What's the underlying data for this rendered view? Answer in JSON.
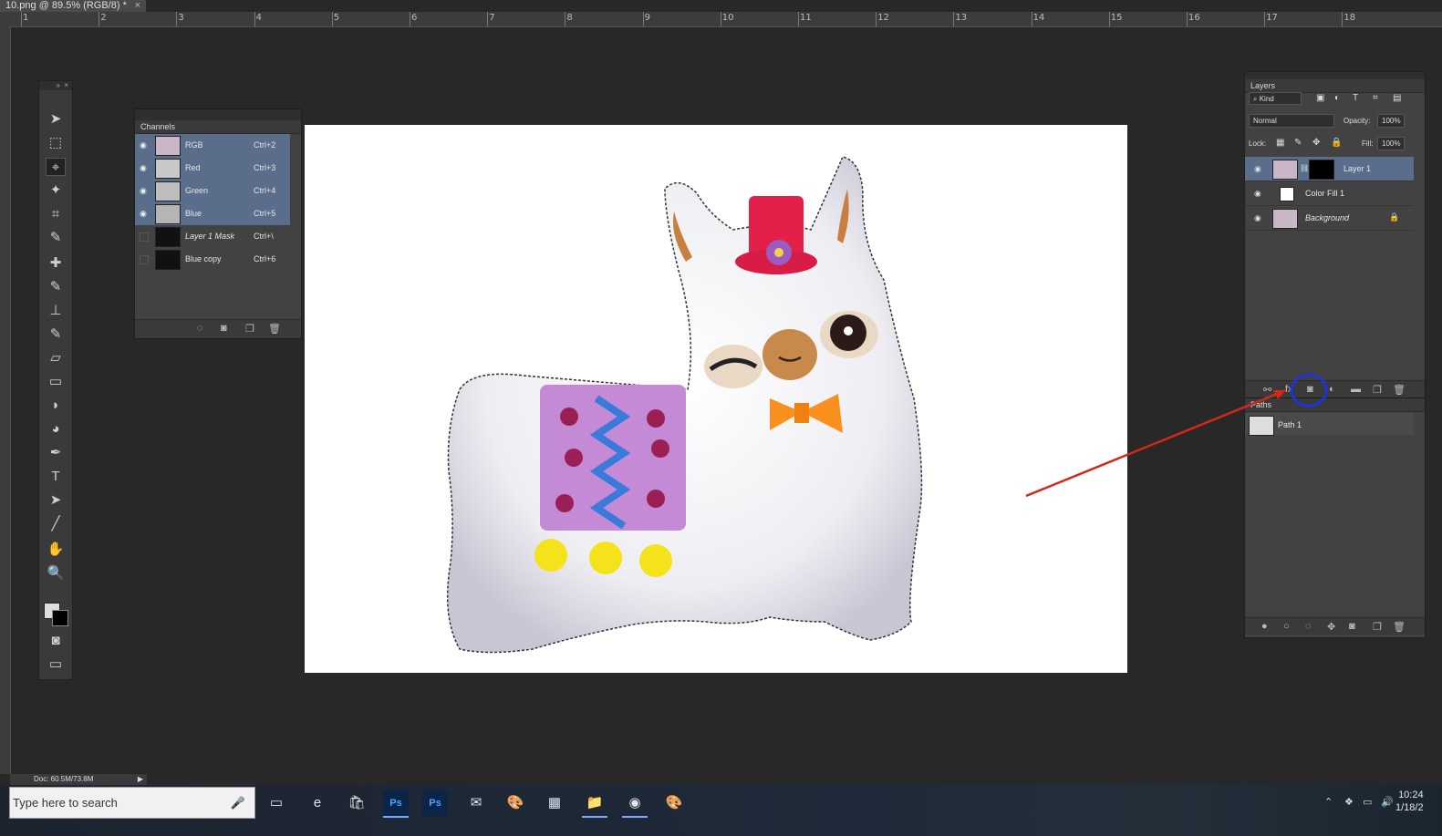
{
  "document": {
    "tab_title": "10.png @ 89.5% (RGB/8) *",
    "close": "×"
  },
  "ruler": {
    "ticks": [
      "1",
      "2",
      "3",
      "4",
      "5",
      "6",
      "7",
      "8",
      "9",
      "10",
      "11",
      "12",
      "13",
      "14",
      "15",
      "16",
      "17",
      "18"
    ]
  },
  "toolbar": {
    "tools": [
      "move-tool",
      "marquee-tool",
      "polygonal-lasso-tool",
      "magic-wand-tool",
      "crop-tool",
      "eyedropper-tool",
      "healing-brush-tool",
      "brush-tool",
      "clone-stamp-tool",
      "history-brush-tool",
      "eraser-tool",
      "gradient-tool",
      "blur-tool",
      "dodge-tool",
      "pen-tool",
      "type-tool",
      "path-selection-tool",
      "line-tool",
      "hand-tool",
      "zoom-tool"
    ],
    "glyphs": [
      "➤",
      "⬚",
      "⌖",
      "✦",
      "⌗",
      "✎",
      "✚",
      "✎",
      "⊥",
      "✎",
      "▱",
      "▭",
      "◗",
      "◕",
      "✒",
      "T",
      "➤",
      "╱",
      "✋",
      "🔍"
    ],
    "active_tool": "polygonal-lasso-tool"
  },
  "channels": {
    "title": "Channels",
    "rows": [
      {
        "name": "RGB",
        "shortcut": "Ctrl+2",
        "visible": true,
        "selected": true
      },
      {
        "name": "Red",
        "shortcut": "Ctrl+3",
        "visible": true,
        "selected": true
      },
      {
        "name": "Green",
        "shortcut": "Ctrl+4",
        "visible": true,
        "selected": true
      },
      {
        "name": "Blue",
        "shortcut": "Ctrl+5",
        "visible": true,
        "selected": true
      },
      {
        "name": "Layer 1 Mask",
        "shortcut": "Ctrl+\\",
        "visible": false,
        "selected": false
      },
      {
        "name": "Blue copy",
        "shortcut": "Ctrl+6",
        "visible": false,
        "selected": false
      }
    ]
  },
  "layers": {
    "title": "Layers",
    "filter_kind": "Kind",
    "blend_mode": "Normal",
    "opacity_label": "Opacity:",
    "opacity": "100%",
    "lock_label": "Lock:",
    "fill_label": "Fill:",
    "fill": "100%",
    "rows": [
      {
        "name": "Layer 1",
        "selected": true,
        "has_mask": true
      },
      {
        "name": "Color Fill 1",
        "selected": false
      },
      {
        "name": "Background",
        "selected": false,
        "locked": true
      }
    ]
  },
  "paths": {
    "title": "Paths",
    "rows": [
      {
        "name": "Path 1"
      }
    ]
  },
  "status": {
    "doc_size": "Doc: 60.5M/73.8M"
  },
  "taskbar": {
    "search_placeholder": "Type here to search",
    "apps": [
      "task-view",
      "edge",
      "store",
      "photoshop",
      "photoshop-2",
      "mail",
      "paint",
      "calculator",
      "file-explorer",
      "chrome",
      "paint-3d"
    ],
    "app_glyphs": [
      "▭",
      "e",
      "🛍",
      "Ps",
      "Ps",
      "✉",
      "🎨",
      "▦",
      "📁",
      "◉",
      "🎨"
    ],
    "clock_time": "10:24",
    "clock_date": "1/18/2"
  },
  "colors": {
    "annotation_arrow": "#d0281b",
    "annotation_circle": "#1c34d8",
    "selection": "#5a6e8c"
  }
}
